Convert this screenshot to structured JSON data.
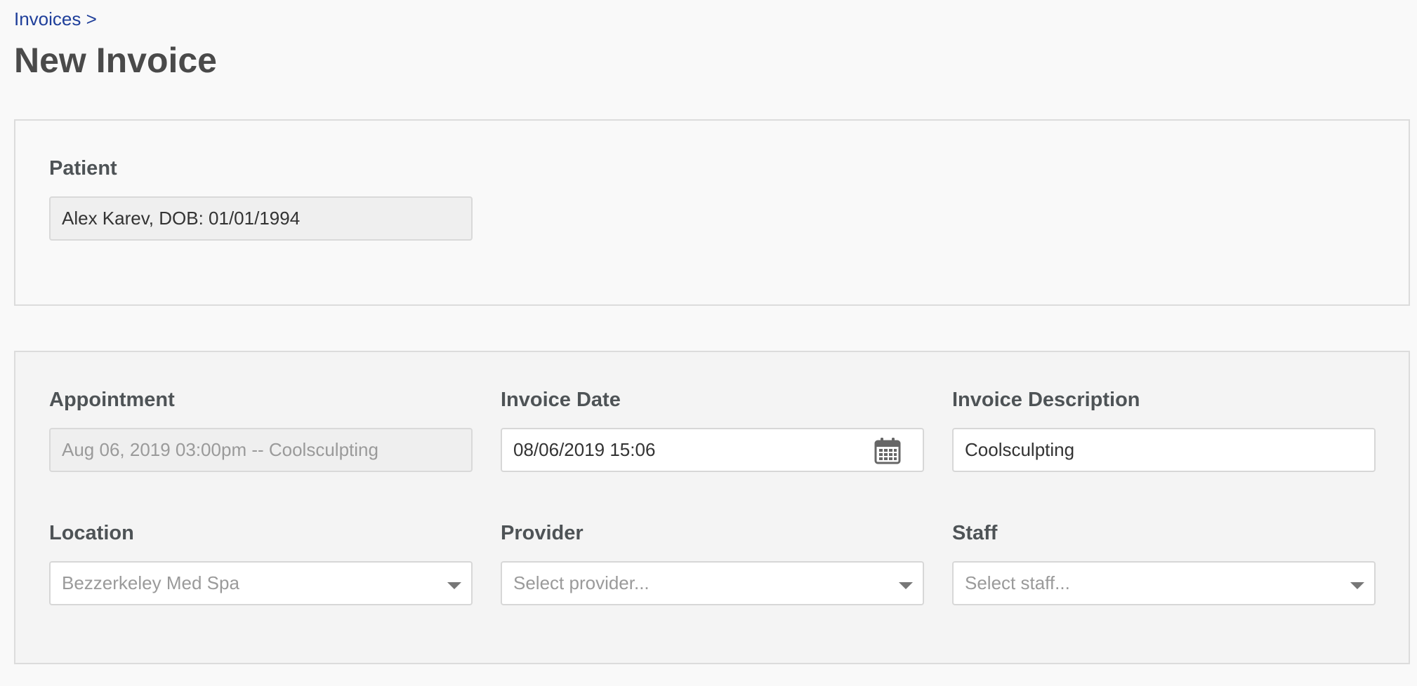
{
  "breadcrumb": {
    "invoices_label": "Invoices >"
  },
  "page": {
    "title": "New Invoice"
  },
  "patient_panel": {
    "label": "Patient",
    "value": "Alex Karev, DOB: 01/01/1994"
  },
  "details_panel": {
    "appointment": {
      "label": "Appointment",
      "value": "Aug 06, 2019 03:00pm -- Coolsculpting"
    },
    "invoice_date": {
      "label": "Invoice Date",
      "value": "08/06/2019 15:06",
      "icon": "calendar-icon"
    },
    "invoice_description": {
      "label": "Invoice Description",
      "value": "Coolsculpting"
    },
    "location": {
      "label": "Location",
      "value": "Bezzerkeley Med Spa",
      "icon": "chevron-down-icon"
    },
    "provider": {
      "label": "Provider",
      "placeholder": "Select provider...",
      "icon": "chevron-down-icon"
    },
    "staff": {
      "label": "Staff",
      "placeholder": "Select staff...",
      "icon": "chevron-down-icon"
    }
  },
  "colors": {
    "link": "#1f3f9a",
    "title": "#4a4a4a",
    "label": "#4e5356",
    "placeholder": "#9a9a9a",
    "panel_border": "#dcdcdc"
  }
}
